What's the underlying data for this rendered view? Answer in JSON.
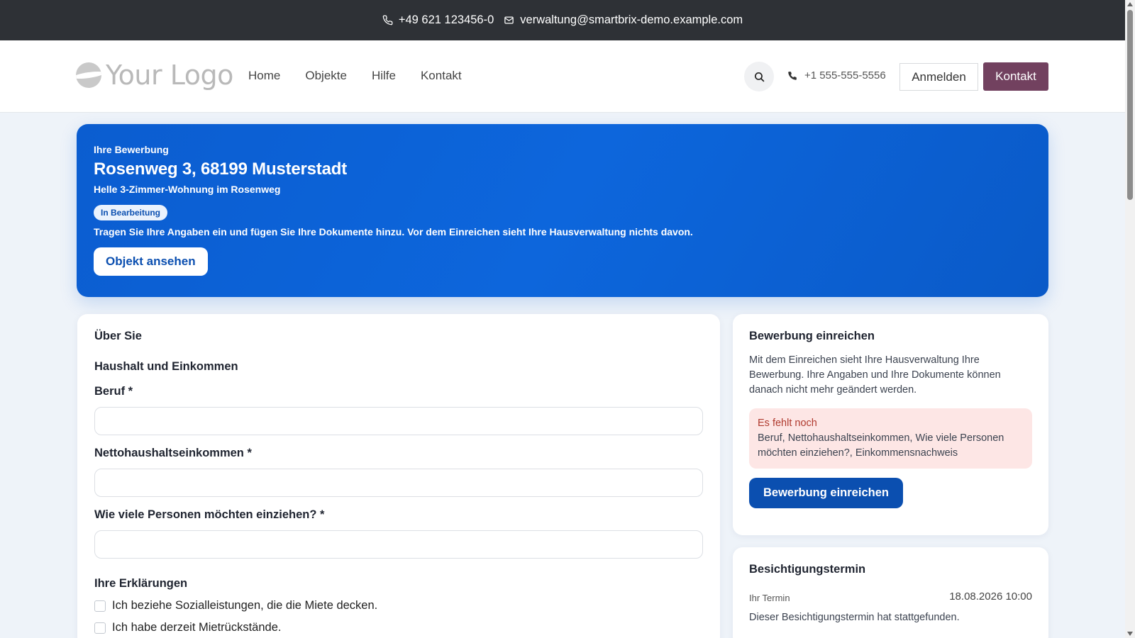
{
  "topbar": {
    "phone": "+49 621 123456-0",
    "email": "verwaltung@smartbrix-demo.example.com",
    "phone_icon": "phone-icon",
    "email_icon": "mail-icon"
  },
  "navbar": {
    "logo_text": "Your Logo",
    "menu": [
      {
        "label": "Home"
      },
      {
        "label": "Objekte"
      },
      {
        "label": "Hilfe"
      },
      {
        "label": "Kontakt"
      }
    ],
    "search_icon": "search-icon",
    "phone": "+1 555-555-5556",
    "login_label": "Anmelden",
    "contact_label": "Kontakt"
  },
  "hero": {
    "eyebrow": "Ihre Bewerbung",
    "title": "Rosenweg 3, 68199 Musterstadt",
    "subtitle": "Helle 3-Zimmer-Wohnung im Rosenweg",
    "status_badge": "In Bearbeitung",
    "note": "Tragen Sie Ihre Angaben ein und fügen Sie Ihre Dokumente hinzu. Vor dem Einreichen sieht Ihre Hausverwaltung nichts davon.",
    "view_button": "Objekt ansehen"
  },
  "form": {
    "section_title": "Über Sie",
    "subsection_title": "Haushalt und Einkommen",
    "fields": [
      {
        "label": "Beruf *",
        "value": ""
      },
      {
        "label": "Nettohaushaltseinkommen *",
        "value": ""
      },
      {
        "label": "Wie viele Personen möchten einziehen? *",
        "value": ""
      }
    ],
    "declarations_title": "Ihre Erklärungen",
    "declarations": [
      {
        "label": "Ich beziehe Sozialleistungen, die die Miete decken.",
        "checked": false
      },
      {
        "label": "Ich habe derzeit Mietrückstände.",
        "checked": false
      }
    ]
  },
  "submit_card": {
    "title": "Bewerbung einreichen",
    "text": "Mit dem Einreichen sieht Ihre Hausverwaltung Ihre Bewerbung. Ihre Angaben und Ihre Dokumente können danach nicht mehr geändert werden.",
    "missing_title": "Es fehlt noch",
    "missing_list": "Beruf, Nettohaushaltseinkommen, Wie viele Personen möchten einziehen?, Einkommensnachweis",
    "button": "Bewerbung einreichen"
  },
  "appointment_card": {
    "title": "Besichtigungstermin",
    "label": "Ihr Termin",
    "value": "18.08.2026 10:00",
    "note": "Dieser Besichtigungstermin hat stattgefunden."
  },
  "colors": {
    "topbar_bg": "#2e3136",
    "hero_bg": "#0b5dd0",
    "primary_button": "#0b4fb0",
    "contact_button": "#72415f",
    "missing_bg": "#fde6e5",
    "page_bg": "#eef3f9"
  }
}
